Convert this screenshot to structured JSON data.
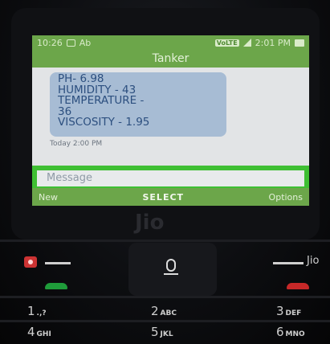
{
  "status_bar": {
    "left_text": "10:26",
    "network_badge": "Ab",
    "volte_badge": "VoLTE",
    "time": "2:01 PM",
    "icons": [
      "box-icon",
      "signal-icon",
      "battery-icon"
    ]
  },
  "title": "Tanker",
  "message": {
    "lines": [
      "PH- 6.98",
      "HUMIDITY - 43",
      "TEMPERATURE -",
      "36",
      "VISCOSITY - 1.95"
    ],
    "timestamp": "Today 2:00 PM"
  },
  "compose": {
    "placeholder": "Message"
  },
  "softkeys": {
    "left": "New",
    "center": "SELECT",
    "right": "Options"
  },
  "brand": "Jio",
  "keypad": {
    "right_soft_label": "Jio",
    "keys": [
      {
        "num": "1",
        "sub": ".,?"
      },
      {
        "num": "2",
        "sub": "ABC"
      },
      {
        "num": "3",
        "sub": "DEF"
      },
      {
        "num": "4",
        "sub": "GHI"
      },
      {
        "num": "5",
        "sub": "JKL"
      },
      {
        "num": "6",
        "sub": "MNO"
      }
    ]
  },
  "colors": {
    "header_green": "#6ca64a",
    "compose_green": "#3fbf33",
    "bubble_blue": "#a7bcd4",
    "text_blue": "#2c4f7f"
  }
}
